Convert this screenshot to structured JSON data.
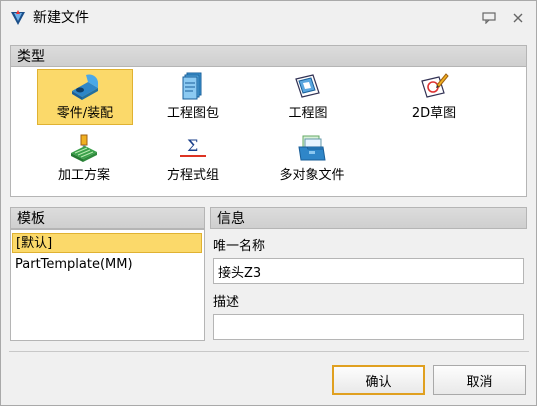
{
  "window": {
    "title": "新建文件"
  },
  "type_section": {
    "header": "类型",
    "items": [
      {
        "label": "零件/装配",
        "icon": "part-assembly-icon",
        "selected": true
      },
      {
        "label": "工程图包",
        "icon": "drawing-package-icon",
        "selected": false
      },
      {
        "label": "工程图",
        "icon": "drawing-icon",
        "selected": false
      },
      {
        "label": "2D草图",
        "icon": "sketch-2d-icon",
        "selected": false
      },
      {
        "label": "加工方案",
        "icon": "machining-plan-icon",
        "selected": false
      },
      {
        "label": "方程式组",
        "icon": "equation-set-icon",
        "selected": false
      },
      {
        "label": "多对象文件",
        "icon": "multi-object-file-icon",
        "selected": false
      }
    ]
  },
  "template_section": {
    "header": "模板",
    "items": [
      {
        "label": "[默认]",
        "selected": true
      },
      {
        "label": "PartTemplate(MM)",
        "selected": false
      }
    ]
  },
  "info_section": {
    "header": "信息",
    "name_label": "唯一名称",
    "name_value": "接头Z3",
    "desc_label": "描述",
    "desc_value": ""
  },
  "buttons": {
    "ok": "确认",
    "cancel": "取消"
  },
  "colors": {
    "selection": "#fbd96a",
    "selection_border": "#e0b232",
    "primary_border": "#e0a020"
  }
}
